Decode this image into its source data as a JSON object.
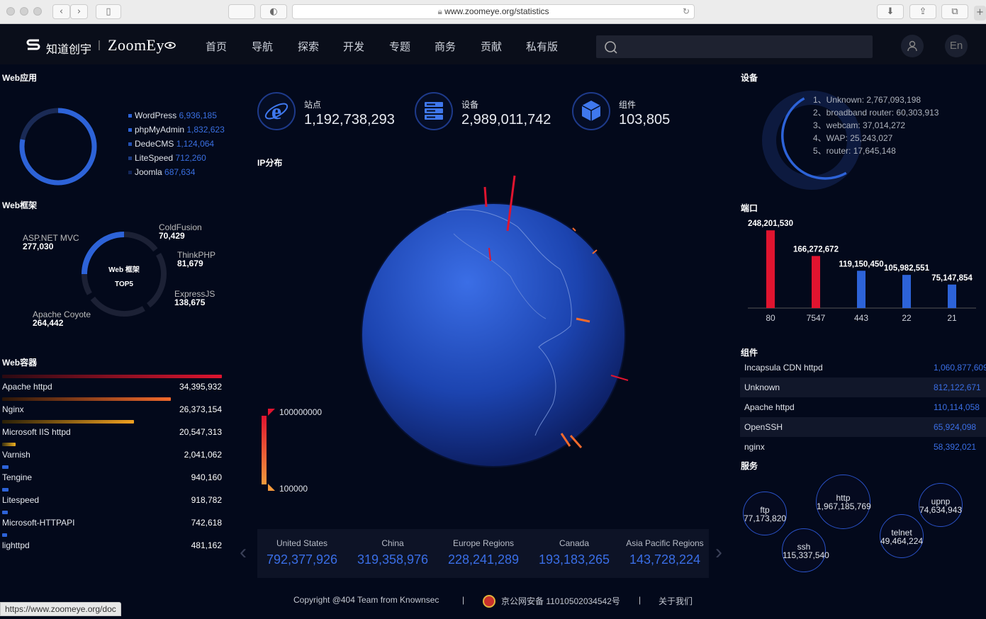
{
  "browser": {
    "url": "www.zoomeye.org/statistics",
    "status_url": "https://www.zoomeye.org/doc"
  },
  "nav": {
    "logo_cn": "知道创宇",
    "logo_sep": "|",
    "logo_en": "ZoomEy",
    "items": [
      "首页",
      "导航",
      "探索",
      "开发",
      "专题",
      "商务",
      "贡献",
      "私有版"
    ],
    "lang": "En"
  },
  "web_app": {
    "title": "Web应用",
    "items": [
      {
        "name": "WordPress",
        "value": "6,936,185"
      },
      {
        "name": "phpMyAdmin",
        "value": "1,832,623"
      },
      {
        "name": "DedeCMS",
        "value": "1,124,064"
      },
      {
        "name": "LiteSpeed",
        "value": "712,260"
      },
      {
        "name": "Joomla",
        "value": "687,634"
      }
    ]
  },
  "web_framework": {
    "title": "Web框架",
    "center_line1": "Web 框架",
    "center_line2": "TOP5",
    "items": [
      {
        "name": "ASP.NET MVC",
        "value": "277,030"
      },
      {
        "name": "ColdFusion",
        "value": "70,429"
      },
      {
        "name": "ThinkPHP",
        "value": "81,679"
      },
      {
        "name": "ExpressJS",
        "value": "138,675"
      },
      {
        "name": "Apache Coyote",
        "value": "264,442"
      }
    ]
  },
  "web_container": {
    "title": "Web容器",
    "items": [
      {
        "name": "Apache httpd",
        "value": "34,395,932"
      },
      {
        "name": "Nginx",
        "value": "26,373,154"
      },
      {
        "name": "Microsoft IIS httpd",
        "value": "20,547,313"
      },
      {
        "name": "Varnish",
        "value": "2,041,062"
      },
      {
        "name": "Tengine",
        "value": "940,160"
      },
      {
        "name": "Litespeed",
        "value": "918,782"
      },
      {
        "name": "Microsoft-HTTPAPI",
        "value": "742,618"
      },
      {
        "name": "lighttpd",
        "value": "481,162"
      }
    ]
  },
  "stats": [
    {
      "label": "站点",
      "value": "1,192,738,293"
    },
    {
      "label": "设备",
      "value": "2,989,011,742"
    },
    {
      "label": "组件",
      "value": "103,805"
    }
  ],
  "ip_dist": {
    "title": "IP分布",
    "legend_max": "100000000",
    "legend_min": "100000"
  },
  "regions": [
    {
      "name": "United States",
      "value": "792,377,926"
    },
    {
      "name": "China",
      "value": "319,358,976"
    },
    {
      "name": "Europe Regions",
      "value": "228,241,289"
    },
    {
      "name": "Canada",
      "value": "193,183,265"
    },
    {
      "name": "Asia Pacific Regions",
      "value": "143,728,224"
    }
  ],
  "devices": {
    "title": "设备",
    "items": [
      "1、Unknown: 2,767,093,198",
      "2、broadband router: 60,303,913",
      "3、webcam: 37,014,272",
      "4、WAP: 25,243,027",
      "5、router: 17,645,148"
    ]
  },
  "ports": {
    "title": "端口"
  },
  "components": {
    "title": "组件",
    "items": [
      {
        "name": "Incapsula CDN httpd",
        "value": "1,060,877,609"
      },
      {
        "name": "Unknown",
        "value": "812,122,671"
      },
      {
        "name": "Apache httpd",
        "value": "110,114,058"
      },
      {
        "name": "OpenSSH",
        "value": "65,924,098"
      },
      {
        "name": "nginx",
        "value": "58,392,021"
      }
    ]
  },
  "services": {
    "title": "服务",
    "items": [
      {
        "name": "ftp",
        "value": "77,173,820"
      },
      {
        "name": "http",
        "value": "1,967,185,769"
      },
      {
        "name": "ssh",
        "value": "115,337,540"
      },
      {
        "name": "telnet",
        "value": "49,464,224"
      },
      {
        "name": "upnp",
        "value": "74,634,943"
      }
    ]
  },
  "footer": {
    "copyright": "Copyright @404 Team from Knownsec",
    "sep": "|",
    "beian": "京公网安备 11010502034542号",
    "about": "关于我们"
  },
  "chart_data": {
    "type": "bar",
    "categories": [
      "80",
      "7547",
      "443",
      "22",
      "21"
    ],
    "values": [
      248201530,
      166272672,
      119150450,
      105982551,
      75147854
    ],
    "labels": [
      "248,201,530",
      "166,272,672",
      "119,150,450",
      "105,982,551",
      "75,147,854"
    ],
    "colors": [
      "#e0142f",
      "#e0142f",
      "#2d63d8",
      "#2d63d8",
      "#2d63d8"
    ],
    "ylim": [
      0,
      260000000
    ],
    "grid": false
  }
}
